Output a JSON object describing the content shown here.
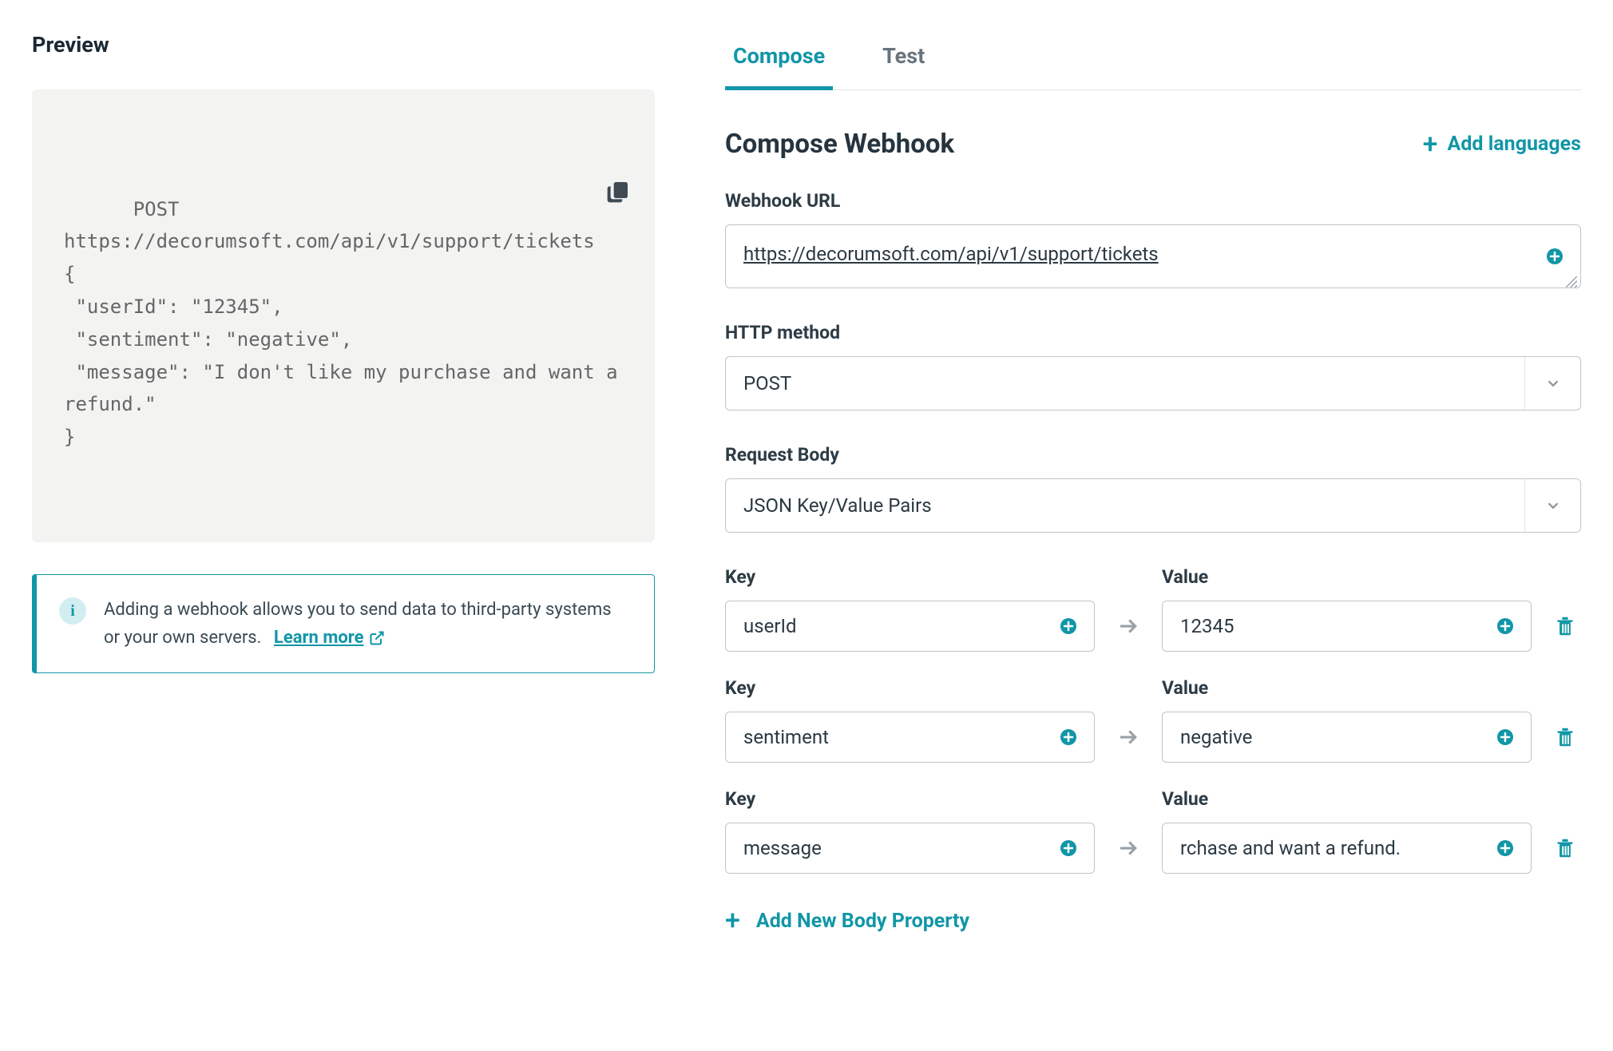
{
  "left": {
    "title": "Preview",
    "preview_text": "POST\nhttps://decorumsoft.com/api/v1/support/tickets\n{\n \"userId\": \"12345\",\n \"sentiment\": \"negative\",\n \"message\": \"I don't like my purchase and want a refund.\"\n}",
    "info_text": "Adding a webhook allows you to send data to third-party systems or your own servers.",
    "learn_more": "Learn more"
  },
  "tabs": {
    "compose": "Compose",
    "test": "Test"
  },
  "compose": {
    "title": "Compose Webhook",
    "add_languages": "Add languages",
    "url_label": "Webhook URL",
    "url_value": "https://decorumsoft.com/api/v1/support/tickets",
    "http_method_label": "HTTP method",
    "http_method_value": "POST",
    "request_body_label": "Request Body",
    "request_body_value": "JSON Key/Value Pairs",
    "key_label": "Key",
    "value_label": "Value",
    "rows": [
      {
        "key": "userId",
        "value": "12345"
      },
      {
        "key": "sentiment",
        "value": "negative"
      },
      {
        "key": "message",
        "value": "rchase and want a refund."
      }
    ],
    "add_body_property": "Add New Body Property"
  }
}
